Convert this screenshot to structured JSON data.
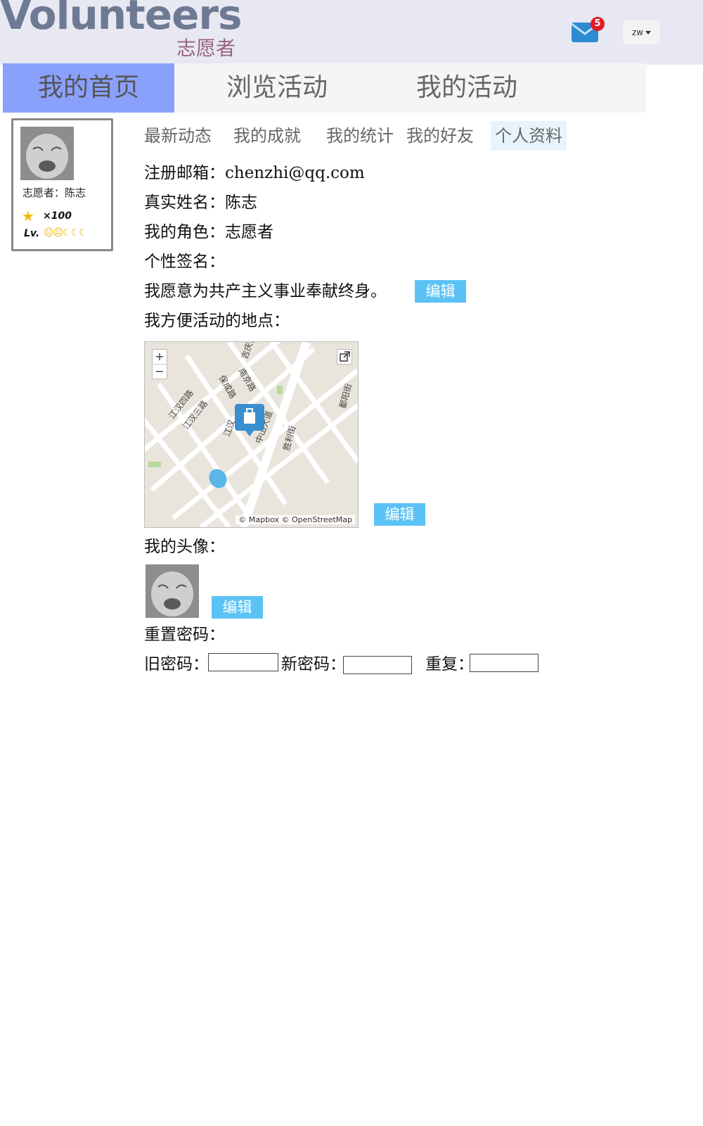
{
  "header": {
    "logo": "Volunteers",
    "logo_sub": "志愿者",
    "mail_count": "5",
    "user_menu": "zw"
  },
  "mainnav": {
    "tabs": [
      {
        "label": "我的首页",
        "active": true
      },
      {
        "label": "浏览活动",
        "active": false
      },
      {
        "label": "我的活动",
        "active": false
      }
    ]
  },
  "card": {
    "name": "志愿者：陈志",
    "score": "×100",
    "level_label": "Lv."
  },
  "subtabs": [
    {
      "label": "最新动态"
    },
    {
      "label": "我的成就"
    },
    {
      "label": "我的统计"
    },
    {
      "label": "我的好友"
    },
    {
      "label": "个人资料",
      "active": true
    }
  ],
  "profile": {
    "email_line": "注册邮箱：chenzhi@qq.com",
    "realname_line": "真实姓名：陈志",
    "role_line": "我的角色：志愿者",
    "signature_label": "个性签名：",
    "signature_text": "我愿意为共产主义事业奉献终身。",
    "location_label": "我方便活动的地点：",
    "avatar_label": "我的头像：",
    "reset_label": "重置密码：",
    "old_pw_label": "旧密码：",
    "new_pw_label": "新密码：",
    "repeat_label": "重复：",
    "edit_label": "编辑"
  },
  "map": {
    "attribution": "© Mapbox © OpenStreetMap",
    "streets": [
      "江汉四路",
      "江汉三路",
      "保成路",
      "南京路",
      "吉庆街",
      "中山大道",
      "胜利街",
      "鄱阳街",
      "江汉"
    ]
  },
  "colors": {
    "header_bg": "#e8e8f3",
    "nav_active": "#8aa1fc",
    "edit_button": "#5bc2f5",
    "badge": "#e31b23"
  }
}
